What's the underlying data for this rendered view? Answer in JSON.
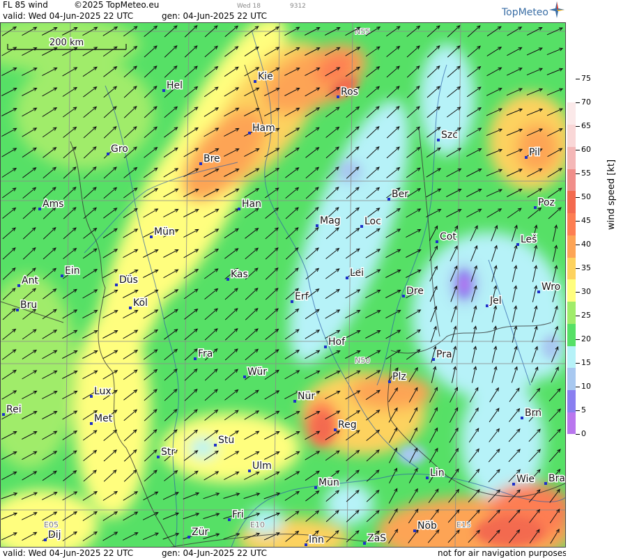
{
  "header": {
    "title": "FL 85 wind",
    "copyright": "©2025 TopMeteo.eu",
    "day_code": "Wed 18",
    "run_code": "9312",
    "valid": "valid:  Wed  04-Jun-2025  22 UTC",
    "gen": "gen: 04-Jun-2025  22 UTC",
    "logo_text": "TopMeteo"
  },
  "footer": {
    "valid": "valid:  Wed  04-Jun-2025  22 UTC",
    "gen": "gen: 04-Jun-2025  22 UTC",
    "disclaimer": "not for air navigation purposes"
  },
  "scale_bar": "200 km",
  "grid_labels": [
    "N55",
    "N50",
    "E05",
    "E10",
    "E15"
  ],
  "legend": {
    "title": "wind speed [kt]",
    "ticks": [
      "75",
      "70",
      "65",
      "60",
      "55",
      "50",
      "45",
      "40",
      "35",
      "30",
      "25",
      "20",
      "15",
      "10",
      "5",
      "0"
    ],
    "colors": [
      "#b977ee",
      "#8a7ff0",
      "#a8c8f0",
      "#b6f2f8",
      "#56e066",
      "#a0ec6a",
      "#fffe7e",
      "#fdd25e",
      "#fda455",
      "#fd7e52",
      "#f36a4f",
      "#f08e8a",
      "#f4b7b7",
      "#f9d7d7",
      "#fbe9e9"
    ]
  },
  "cities": [
    {
      "name": "Hel"
    },
    {
      "name": "Kie"
    },
    {
      "name": "Ros"
    },
    {
      "name": "Ham"
    },
    {
      "name": "Szc"
    },
    {
      "name": "Gro"
    },
    {
      "name": "Bre"
    },
    {
      "name": "Pil"
    },
    {
      "name": "Ams"
    },
    {
      "name": "Han"
    },
    {
      "name": "Ber"
    },
    {
      "name": "Poz"
    },
    {
      "name": "Mag"
    },
    {
      "name": "Loc"
    },
    {
      "name": "Mün"
    },
    {
      "name": "Cot"
    },
    {
      "name": "Leš"
    },
    {
      "name": "Ein"
    },
    {
      "name": "Kas"
    },
    {
      "name": "Lei"
    },
    {
      "name": "Ant"
    },
    {
      "name": "Düs"
    },
    {
      "name": "Dre"
    },
    {
      "name": "Wro"
    },
    {
      "name": "Erf"
    },
    {
      "name": "Jel"
    },
    {
      "name": "Köl"
    },
    {
      "name": "Bru"
    },
    {
      "name": "Hof"
    },
    {
      "name": "Fra"
    },
    {
      "name": "Pra"
    },
    {
      "name": "Wür"
    },
    {
      "name": "Plz"
    },
    {
      "name": "Lux"
    },
    {
      "name": "Nür"
    },
    {
      "name": "Rei"
    },
    {
      "name": "Met"
    },
    {
      "name": "Reg"
    },
    {
      "name": "Brn"
    },
    {
      "name": "Stu"
    },
    {
      "name": "Str"
    },
    {
      "name": "Ulm"
    },
    {
      "name": "Lin"
    },
    {
      "name": "Wie"
    },
    {
      "name": "Bra"
    },
    {
      "name": "Mün"
    },
    {
      "name": "Fri"
    },
    {
      "name": "Nöb"
    },
    {
      "name": "Zür"
    },
    {
      "name": "Dij"
    },
    {
      "name": "Inn"
    },
    {
      "name": "ZaS"
    }
  ]
}
